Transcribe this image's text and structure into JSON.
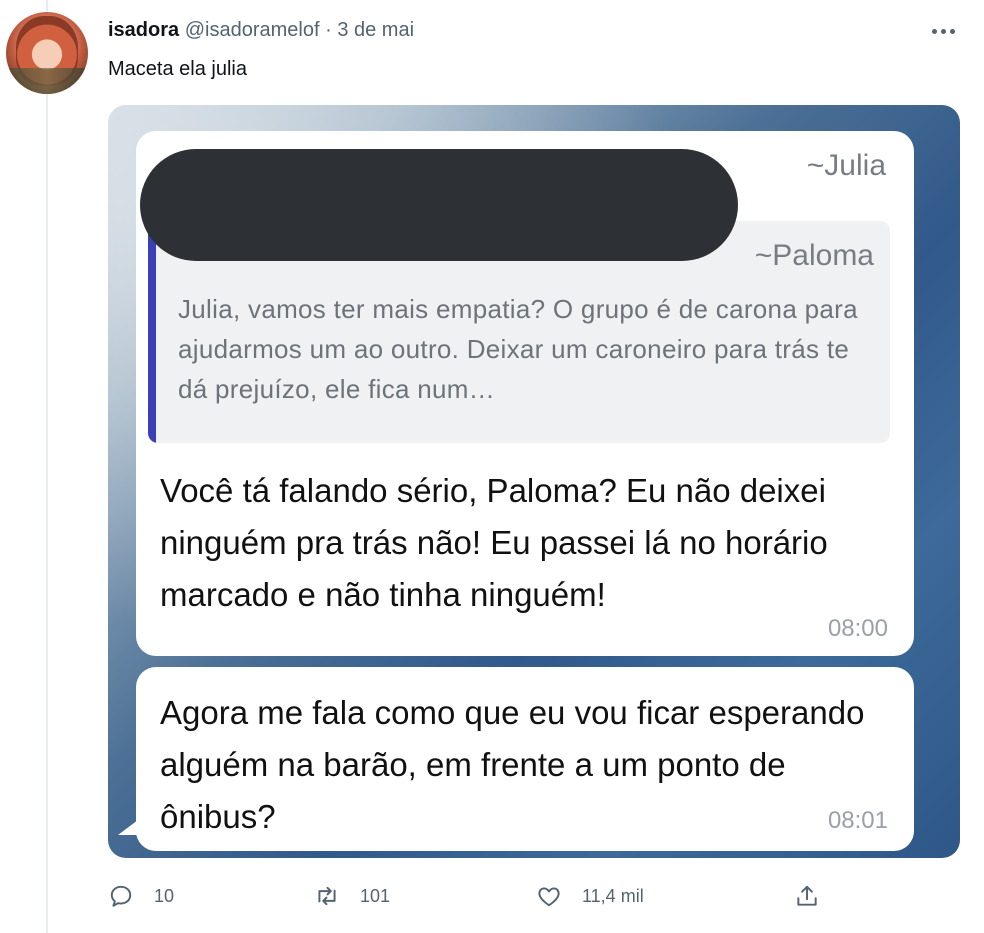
{
  "tweet": {
    "display_name": "isadora",
    "handle": "@isadoramelof",
    "separator": "·",
    "date": "3 de mai",
    "text": "Maceta ela julia"
  },
  "media": {
    "message1": {
      "sender": "~Julia",
      "quoted_sender": "~Paloma",
      "quoted_text": "Julia, vamos ter mais empatia? O grupo é de carona para ajudarmos um ao outro. Deixar um caroneiro para trás te dá prejuízo,  ele fica num…",
      "text": "Você tá falando sério, Paloma? Eu não deixei ninguém pra trás não! Eu passei lá no horário marcado e não tinha ninguém!",
      "time": "08:00"
    },
    "message2": {
      "text": "Agora me fala como que eu vou ficar esperando alguém na barão, em frente a um ponto de ônibus?",
      "time": "08:01"
    },
    "colors": {
      "quote_bar": "#3b40b8",
      "redaction": "#2d3035"
    }
  },
  "actions": {
    "reply_count": "10",
    "retweet_count": "101",
    "like_count": "11,4 mil",
    "icons": [
      "reply-icon",
      "retweet-icon",
      "like-icon",
      "share-icon"
    ]
  },
  "more_icon": "more-options-icon"
}
